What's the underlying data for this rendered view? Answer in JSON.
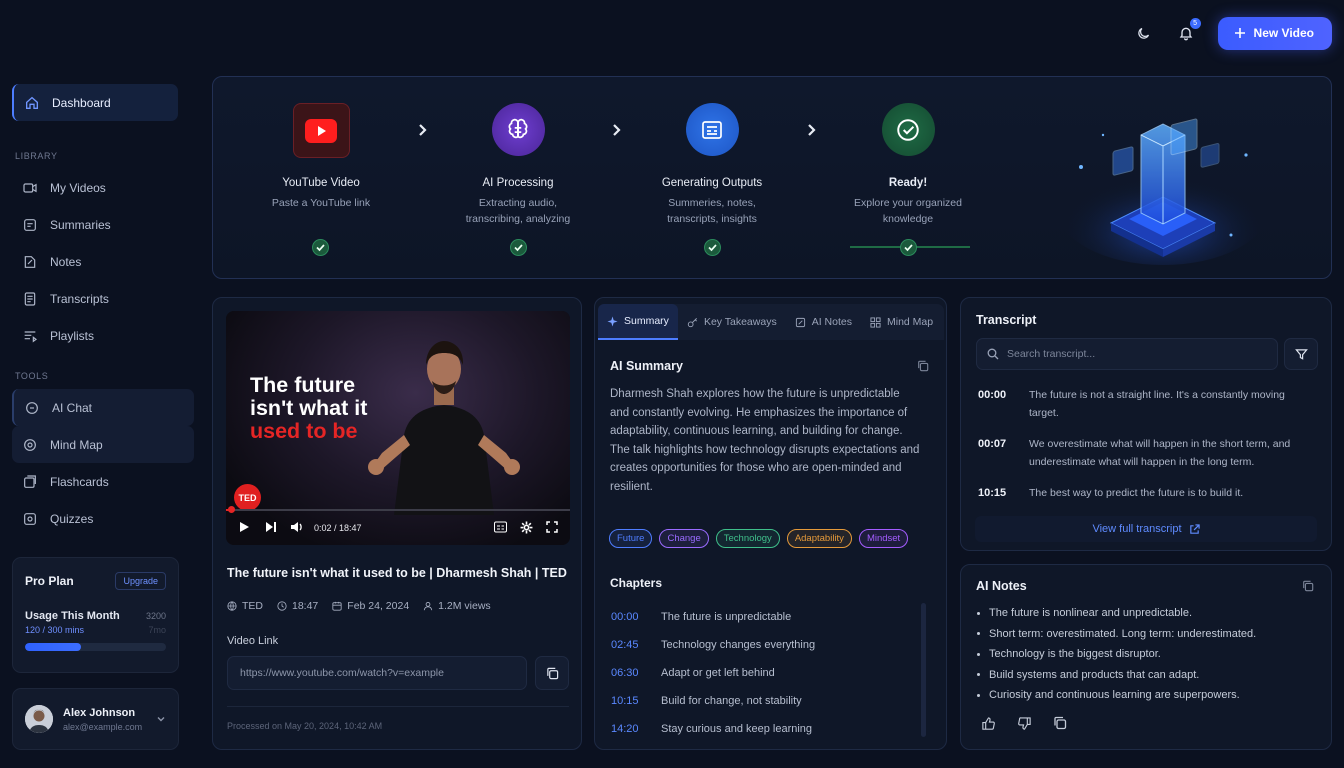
{
  "header": {
    "new_video_label": "New Video",
    "notification_count": "5"
  },
  "sidebar": {
    "dashboard_label": "Dashboard",
    "library_heading": "LIBRARY",
    "library_items": [
      "My Videos",
      "Summaries",
      "Notes",
      "Transcripts",
      "Playlists"
    ],
    "tools_heading": "TOOLS",
    "tools_items": [
      "AI Chat",
      "Mind Map",
      "Flashcards",
      "Quizzes"
    ]
  },
  "plan": {
    "title": "Pro Plan",
    "upgrade_label": "Upgrade",
    "usage_label": "Usage This Month",
    "usage_right": "3200",
    "usage_count": "120 / 300 mins",
    "usage_pace": "7mo",
    "usage_fraction": 0.4
  },
  "user": {
    "name": "Alex Johnson",
    "email": "alex@example.com"
  },
  "workflow": {
    "steps": [
      {
        "title": "YouTube Video",
        "desc": "Paste a YouTube link"
      },
      {
        "title": "AI Processing",
        "desc": "Extracting audio,\ntranscribing, analyzing"
      },
      {
        "title": "Generating Outputs",
        "desc": "Summeries, notes,\ntranscripts, insights"
      },
      {
        "title": "Ready!",
        "desc": "Explore your organized\nknowledge"
      }
    ]
  },
  "video": {
    "headline_line1": "The future",
    "headline_line2": "isn't what it",
    "headline_line3": "used to be",
    "ted_logo": "TED",
    "time": "0:02 / 18:47",
    "progress_fraction": 0.002,
    "title": "The future isn't what it used to be | Dharmesh Shah | TED",
    "channel": "TED",
    "duration": "18:47",
    "date": "Feb 24, 2024",
    "views": "1.2M views",
    "link_label": "Video Link",
    "link_value": "https://www.youtube.com/watch?v=example",
    "processed": "Processed on May 20, 2024, 10:42 AM"
  },
  "summary": {
    "tabs": [
      "Summary",
      "Key Takeaways",
      "AI Notes",
      "Mind Map"
    ],
    "heading": "AI Summary",
    "text": "Dharmesh Shah explores how the future is unpredictable and constantly evolving. He emphasizes the importance of adaptability, continuous learning, and building for change. The talk highlights how technology disrupts expectations and creates opportunities for those who are open-minded and resilient.",
    "tags": [
      {
        "label": "Future",
        "color": "#4f7dff"
      },
      {
        "label": "Change",
        "color": "#9a6bff"
      },
      {
        "label": "Technology",
        "color": "#3fbf8a"
      },
      {
        "label": "Adaptability",
        "color": "#e59a3a"
      },
      {
        "label": "Mindset",
        "color": "#a45cff"
      }
    ],
    "chapters_heading": "Chapters",
    "chapters": [
      {
        "time": "00:00",
        "title": "The future is unpredictable"
      },
      {
        "time": "02:45",
        "title": "Technology changes everything"
      },
      {
        "time": "06:30",
        "title": "Adapt or get left behind"
      },
      {
        "time": "10:15",
        "title": "Build for change, not stability"
      },
      {
        "time": "14:20",
        "title": "Stay curious and keep learning"
      }
    ]
  },
  "transcript": {
    "heading": "Transcript",
    "search_placeholder": "Search transcript...",
    "lines": [
      {
        "time": "00:00",
        "text": "The future is not a straight line. It's a constantly moving target."
      },
      {
        "time": "00:07",
        "text": "We overestimate what will happen in the short term, and underestimate what will happen in the long term."
      },
      {
        "time": "10:15",
        "text": "The best way to predict the future is to build it."
      }
    ],
    "view_full_label": "View full transcript"
  },
  "notes": {
    "heading": "AI Notes",
    "items": [
      "The future is nonlinear and unpredictable.",
      "Short term: overestimated. Long term: underestimated.",
      "Technology is the biggest disruptor.",
      "Build systems and products that can adapt.",
      "Curiosity and continuous learning are superpowers."
    ]
  }
}
